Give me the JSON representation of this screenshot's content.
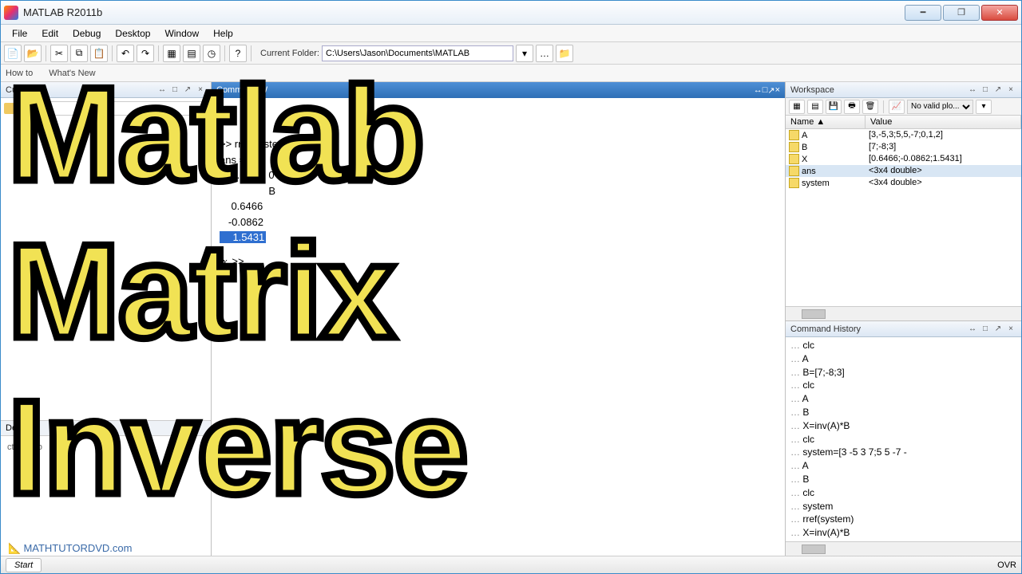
{
  "window": {
    "title": "MATLAB R2011b"
  },
  "menu": {
    "file": "File",
    "edit": "Edit",
    "debug": "Debug",
    "desktop": "Desktop",
    "window": "Window",
    "help": "Help"
  },
  "toolbar": {
    "current_folder_label": "Current Folder:",
    "current_folder_path": "C:\\Users\\Jason\\Documents\\MATLAB"
  },
  "shortcuts": {
    "howto": "How to",
    "whatsnew": "What's New"
  },
  "panels": {
    "current_folder": "Cu",
    "command_window": "Command W",
    "workspace": "Workspace",
    "command_history": "Command History",
    "details": "Detai"
  },
  "details_placeholder": "ct a                   ew o",
  "command_window": {
    "lines": [
      ">> rref(system)",
      "",
      "ans =",
      "",
      "    1.0        0                0.6466",
      "",
      "                 B",
      "",
      "",
      "    0.6466",
      "   -0.0862"
    ],
    "selected_value": "    1.5431",
    "prompt_fx": "fx",
    "prompt": ">>"
  },
  "workspace": {
    "plot_selector": "No valid plo...",
    "col_name": "Name",
    "col_value": "Value",
    "sort": "▲",
    "vars": [
      {
        "name": "A",
        "value": "[3,-5,3;5,5,-7;0,1,2]",
        "sel": false
      },
      {
        "name": "B",
        "value": "[7;-8;3]",
        "sel": false
      },
      {
        "name": "X",
        "value": "[0.6466;-0.0862;1.5431]",
        "sel": false
      },
      {
        "name": "ans",
        "value": "<3x4 double>",
        "sel": true
      },
      {
        "name": "system",
        "value": "<3x4 double>",
        "sel": false
      }
    ]
  },
  "history": {
    "lines": [
      "clc",
      "A",
      "B=[7;-8;3]",
      "clc",
      "A",
      "B",
      "X=inv(A)*B",
      "clc",
      "system=[3 -5 3 7;5 5 -7 -",
      "A",
      "B",
      "clc",
      "system",
      "rref(system)",
      "X=inv(A)*B"
    ]
  },
  "status": {
    "start": "Start",
    "ovr": "OVR"
  },
  "branding": {
    "mathtutor": "MATHTUTORDVD.com"
  },
  "overlay": {
    "l1": "Matlab",
    "l2": "Matrix",
    "l3": "Inverse"
  }
}
